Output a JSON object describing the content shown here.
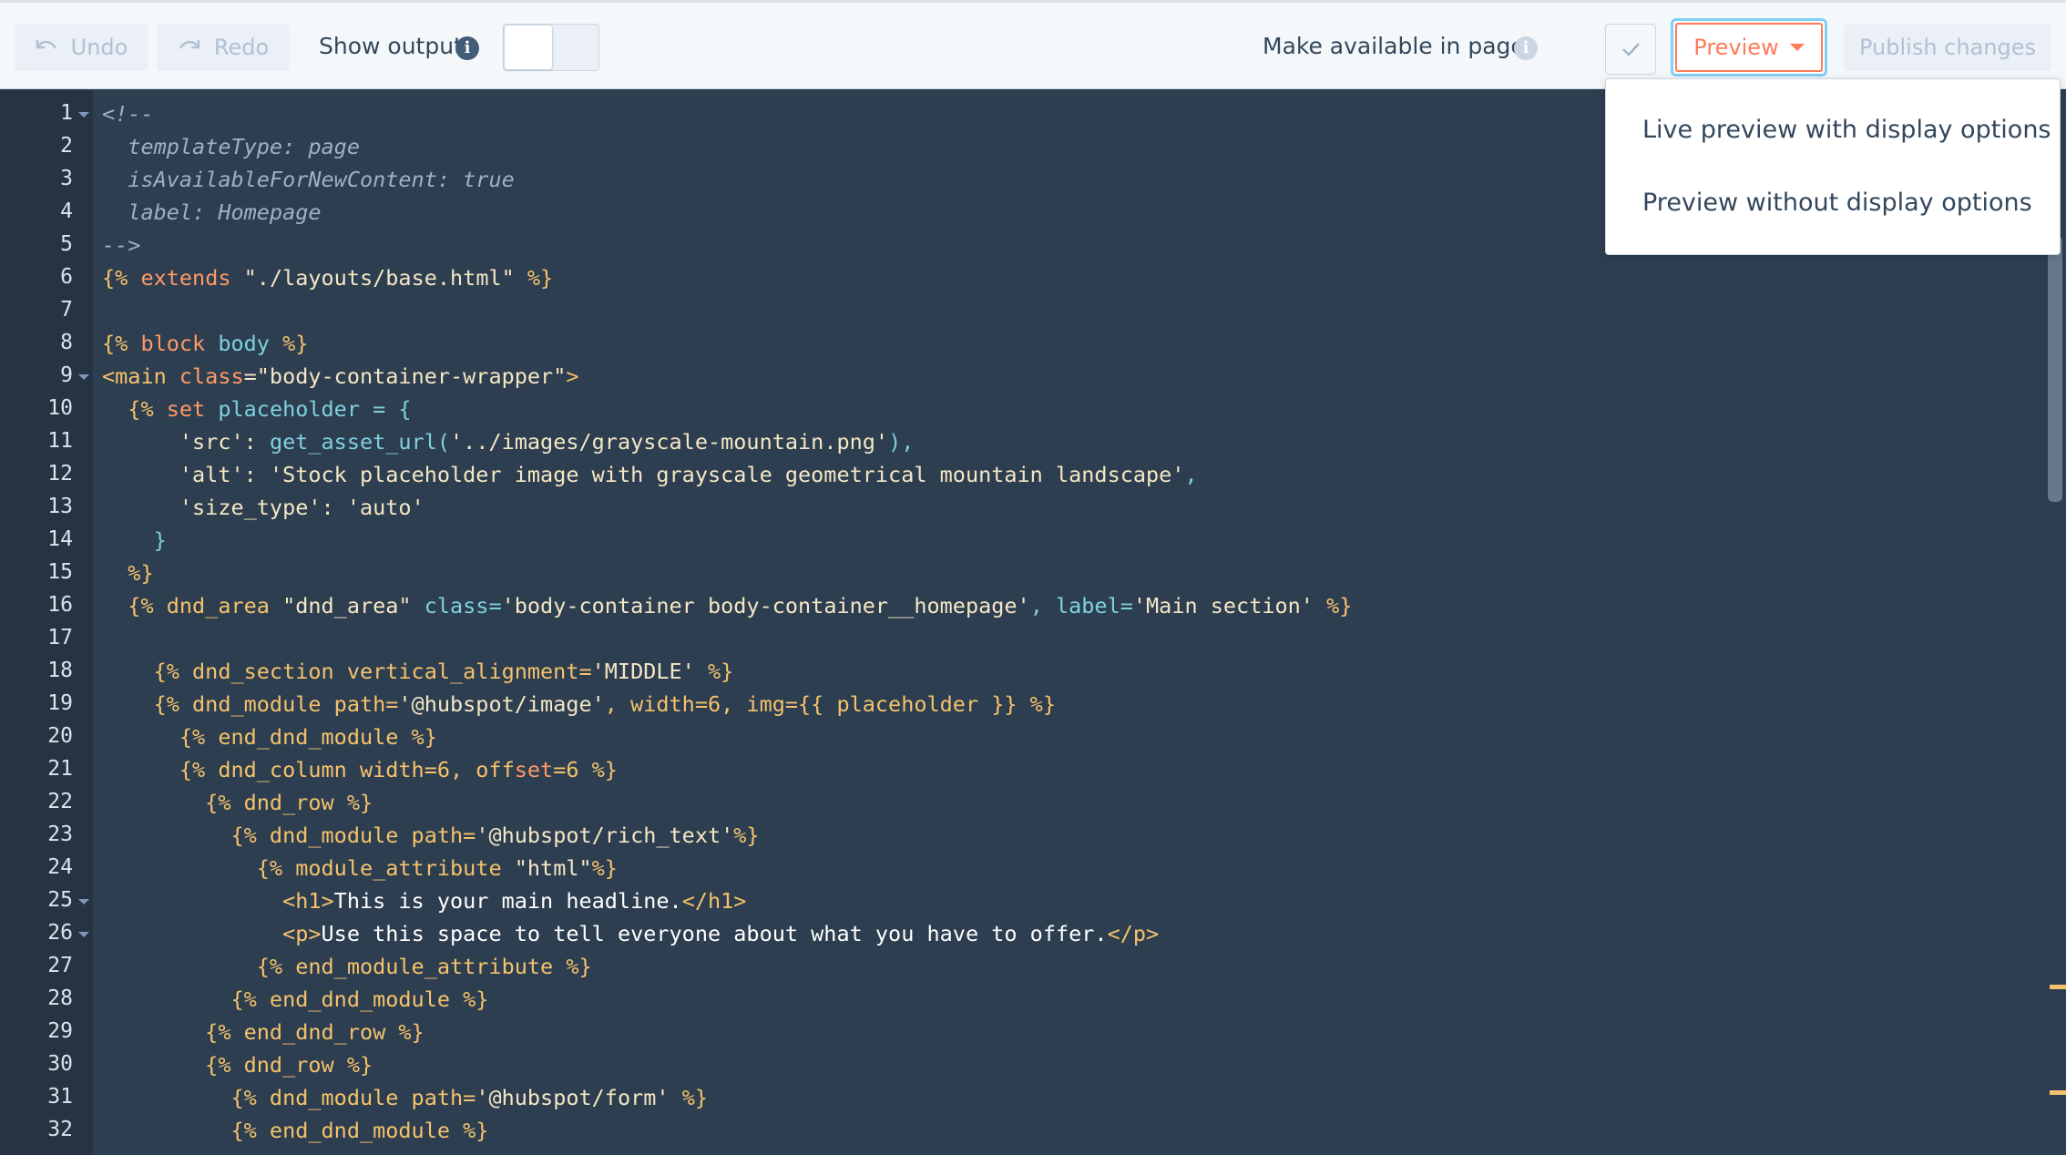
{
  "toolbar": {
    "undo_label": "Undo",
    "redo_label": "Redo",
    "show_output_label": "Show output",
    "make_available_label": "Make available in pages",
    "preview_label": "Preview",
    "publish_label": "Publish changes"
  },
  "preview_menu": {
    "items": [
      "Live preview with display options",
      "Preview without display options"
    ]
  },
  "colors": {
    "accent": "#ff7a59",
    "focus_ring": "#7fd1f5",
    "editor_bg": "#2d3e50",
    "gutter_bg": "#253342",
    "info_icon": "#425b76"
  },
  "editor": {
    "line_numbers": [
      "1",
      "2",
      "3",
      "4",
      "5",
      "6",
      "7",
      "8",
      "9",
      "10",
      "11",
      "12",
      "13",
      "14",
      "15",
      "16",
      "17",
      "18",
      "19",
      "20",
      "21",
      "22",
      "23",
      "24",
      "25",
      "26",
      "27",
      "28",
      "29",
      "30",
      "31",
      "32"
    ],
    "lines": [
      [
        "<!--"
      ],
      [
        "  templateType: page"
      ],
      [
        "  isAvailableForNewContent: true"
      ],
      [
        "  label: Homepage"
      ],
      [
        "-->"
      ],
      [
        "{% ",
        "extends",
        " \"./layouts/base.html\"",
        " %}"
      ],
      [
        ""
      ],
      [
        "{% ",
        "block",
        " body",
        " %}"
      ],
      [
        "<main ",
        "class",
        "=\"body-container-wrapper\"",
        ">"
      ],
      [
        "  {% ",
        "set",
        " placeholder = {"
      ],
      [
        "      'src': ",
        "get_asset_url(",
        "'../images/grayscale-mountain.png'",
        "),"
      ],
      [
        "      'alt': ",
        "'Stock placeholder image with grayscale geometrical mountain landscape'",
        ","
      ],
      [
        "      'size_type': ",
        "'auto'"
      ],
      [
        "    }"
      ],
      [
        "  %}"
      ],
      [
        "  {% dnd_area ",
        "\"dnd_area\"",
        " class=",
        "'body-container body-container__homepage'",
        ", label=",
        "'Main section'",
        " %}"
      ],
      [
        ""
      ],
      [
        "    {% dnd_section vertical_alignment=",
        "'MIDDLE'",
        " %}"
      ],
      [
        "    {% dnd_module path=",
        "'@hubspot/image'",
        ", width=6, img={{ placeholder }} %}"
      ],
      [
        "      {% end_dnd_module %}"
      ],
      [
        "      {% dnd_column width=6, off",
        "set",
        "=6 %}"
      ],
      [
        "        {% dnd_row %}"
      ],
      [
        "          {% dnd_module path=",
        "'@hubspot/rich_text'",
        "%}"
      ],
      [
        "            {% module_attribute ",
        "\"html\"",
        "%}"
      ],
      [
        "              ",
        "<h1>",
        "This is your main headline.",
        "</h1>"
      ],
      [
        "              ",
        "<p>",
        "Use this space to tell everyone about what you have to offer.",
        "</p>"
      ],
      [
        "            {% end_module_attribute %}"
      ],
      [
        "          {% end_dnd_module %}"
      ],
      [
        "        {% end_dnd_row %}"
      ],
      [
        "        {% dnd_row %}"
      ],
      [
        "          {% dnd_module path=",
        "'@hubspot/form'",
        " %}"
      ],
      [
        "          {% end_dnd_module %}"
      ]
    ]
  }
}
